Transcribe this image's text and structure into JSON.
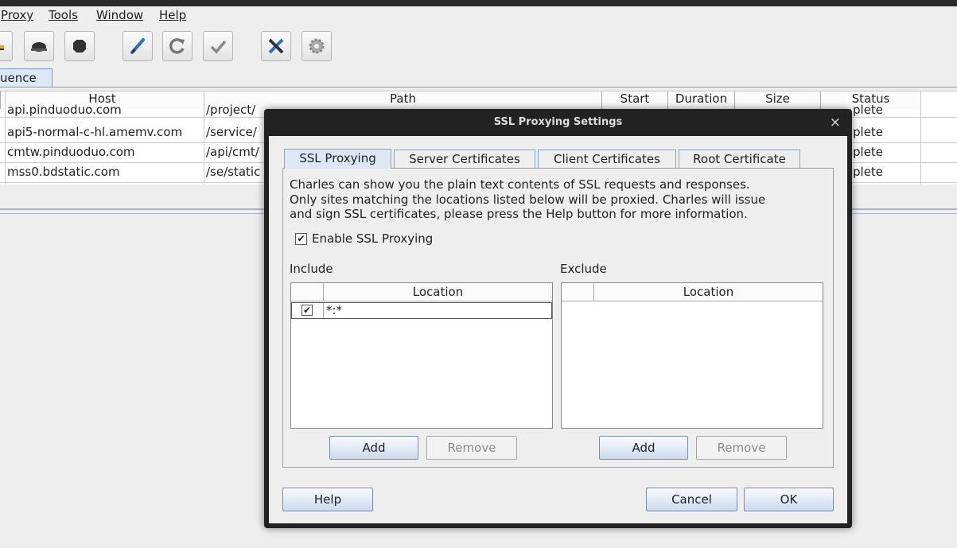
{
  "menubar": {
    "items": [
      "Proxy",
      "Tools",
      "Window",
      "Help"
    ]
  },
  "toolbar": {
    "icons": [
      "feather-icon",
      "turtle-icon",
      "stop-icon",
      "pen-icon",
      "refresh-icon",
      "check-icon",
      "tools-icon",
      "gear-icon"
    ]
  },
  "session_tab": {
    "label": "uence"
  },
  "table": {
    "columns": [
      "Host",
      "Path",
      "Start",
      "Duration",
      "Size",
      "Status"
    ],
    "rows": [
      {
        "host": "api.pinduoduo.com",
        "path": "/project/",
        "status": "plete"
      },
      {
        "host": "api5-normal-c-hl.amemv.com",
        "path": "/service/",
        "status": "plete"
      },
      {
        "host": "cmtw.pinduoduo.com",
        "path": "/api/cmt/",
        "status": "plete"
      },
      {
        "host": "mss0.bdstatic.com",
        "path": "/se/static",
        "status": "plete"
      }
    ]
  },
  "dialog": {
    "title": "SSL Proxying Settings",
    "close": "×",
    "tabs": [
      "SSL Proxying",
      "Server Certificates",
      "Client Certificates",
      "Root Certificate"
    ],
    "description": [
      "Charles can show you the plain text contents of SSL requests and responses.",
      "Only sites matching the locations listed below will be proxied. Charles will issue",
      "and sign SSL certificates, please press the Help button for more information."
    ],
    "enable_label": "Enable SSL Proxying",
    "enable_checked": true,
    "include": {
      "label": "Include",
      "column": "Location",
      "rows": [
        {
          "checked": true,
          "location": "*:*"
        }
      ],
      "add": "Add",
      "remove": "Remove"
    },
    "exclude": {
      "label": "Exclude",
      "column": "Location",
      "rows": [],
      "add": "Add",
      "remove": "Remove"
    },
    "help": "Help",
    "cancel": "Cancel",
    "ok": "OK"
  }
}
